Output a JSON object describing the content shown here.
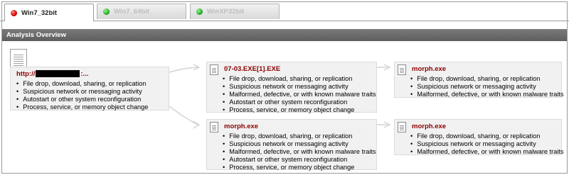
{
  "tabs": [
    {
      "label": "Win7_32bit",
      "status": "red",
      "active": true
    },
    {
      "label": "Win7_64bit",
      "status": "green",
      "active": false
    },
    {
      "label": "WinXP32bit",
      "status": "green",
      "active": false
    }
  ],
  "header": {
    "title": "Analysis Overview"
  },
  "colors": {
    "title_red": "#8b0000",
    "header_bg": "#666666",
    "node_bg": "#f1f1f1"
  },
  "nodes": {
    "root": {
      "title_prefix": "http://",
      "title_suffix": ":...",
      "items": [
        "File drop, download, sharing, or replication",
        "Suspicious network or messaging activity",
        "Autostart or other system reconfiguration",
        "Process, service, or memory object change"
      ]
    },
    "exe1": {
      "title": "07-03.EXE[1].EXE",
      "items": [
        "File drop, download, sharing, or replication",
        "Suspicious network or messaging activity",
        "Malformed, defective, or with known malware traits",
        "Autostart or other system reconfiguration",
        "Process, service, or memory object change"
      ]
    },
    "morph_top_right": {
      "title": "morph.exe",
      "items": [
        "File drop, download, sharing, or replication",
        "Suspicious network or messaging activity",
        "Malformed, defective, or with known malware traits"
      ]
    },
    "morph_mid": {
      "title": "morph.exe",
      "items": [
        "File drop, download, sharing, or replication",
        "Suspicious network or messaging activity",
        "Malformed, defective, or with known malware traits",
        "Autostart or other system reconfiguration",
        "Process, service, or memory object change"
      ]
    },
    "morph_bottom_right": {
      "title": "morph.exe",
      "items": [
        "File drop, download, sharing, or replication",
        "Suspicious network or messaging activity",
        "Malformed, defective, or with known malware traits"
      ]
    }
  }
}
